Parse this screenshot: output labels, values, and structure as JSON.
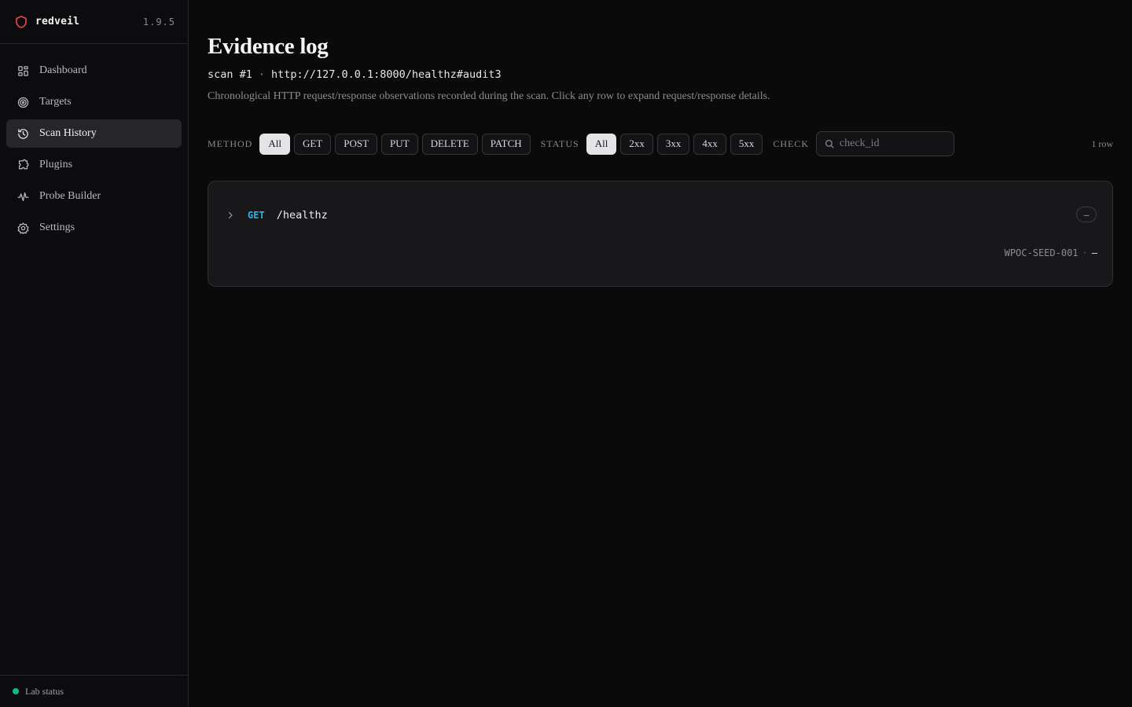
{
  "brand": {
    "name": "redveil",
    "version": "1.9.5",
    "accent": "#e5484d"
  },
  "sidebar": {
    "items": [
      {
        "label": "Dashboard",
        "icon": "grid-icon",
        "active": false
      },
      {
        "label": "Targets",
        "icon": "target-icon",
        "active": false
      },
      {
        "label": "Scan History",
        "icon": "history-icon",
        "active": true
      },
      {
        "label": "Plugins",
        "icon": "puzzle-icon",
        "active": false
      },
      {
        "label": "Probe Builder",
        "icon": "waveform-icon",
        "active": false
      },
      {
        "label": "Settings",
        "icon": "gear-icon",
        "active": false
      }
    ],
    "lab_status": {
      "label": "Lab status",
      "color": "#10b981"
    }
  },
  "page": {
    "title": "Evidence log",
    "scan_id": "scan #1",
    "scan_sep": "·",
    "scan_url": "http://127.0.0.1:8000/healthz#audit3",
    "subtitle": "Chronological HTTP request/response observations recorded during the scan. Click any row to expand request/response details."
  },
  "filters": {
    "method_label": "METHOD",
    "methods": [
      "All",
      "GET",
      "POST",
      "PUT",
      "DELETE",
      "PATCH"
    ],
    "method_selected": "All",
    "status_label": "STATUS",
    "statuses": [
      "All",
      "2xx",
      "3xx",
      "4xx",
      "5xx"
    ],
    "status_selected": "All",
    "check_label": "CHECK",
    "check_placeholder": "check_id",
    "check_value": "",
    "row_count": "1 row"
  },
  "rows": [
    {
      "method": "GET",
      "method_color": "#22b8e8",
      "path": "/healthz",
      "status": "–",
      "check_id": "WPOC-SEED-001",
      "sep": "·",
      "extra": "–"
    }
  ]
}
